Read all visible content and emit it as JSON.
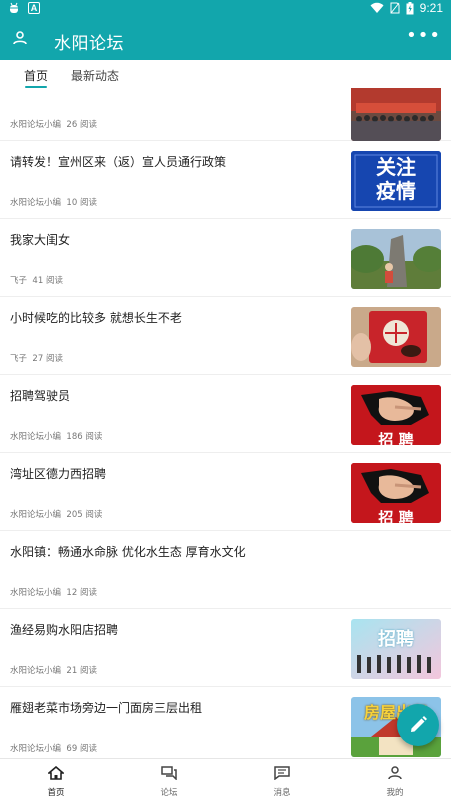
{
  "status_bar": {
    "time": "9:21"
  },
  "app_bar": {
    "title": "水阳论坛"
  },
  "tabs": [
    {
      "label": "首页",
      "active": true
    },
    {
      "label": "最新动态",
      "active": false
    }
  ],
  "posts": [
    {
      "title": "",
      "author": "水阳论坛小编",
      "reads": "26 阅读"
    },
    {
      "title": "请转发！宣州区来（返）宣人员通行政策",
      "author": "水阳论坛小编",
      "reads": "10 阅读",
      "thumb_text_1": "关注",
      "thumb_text_2": "疫情"
    },
    {
      "title": "我家大闺女",
      "author": "飞子",
      "reads": "41 阅读"
    },
    {
      "title": "小时候吃的比较多 就想长生不老",
      "author": "飞子",
      "reads": "27 阅读"
    },
    {
      "title": "招聘驾驶员",
      "author": "水阳论坛小编",
      "reads": "186 阅读",
      "thumb_text": "招 聘"
    },
    {
      "title": "湾址区德力西招聘",
      "author": "水阳论坛小编",
      "reads": "205 阅读",
      "thumb_text": "招 聘"
    },
    {
      "title": "水阳镇：畅通水命脉 优化水生态 厚育水文化",
      "author": "水阳论坛小编",
      "reads": "12 阅读"
    },
    {
      "title": "渔经易购水阳店招聘",
      "author": "水阳论坛小编",
      "reads": "21 阅读",
      "thumb_text": "招聘"
    },
    {
      "title": "雁翅老菜市场旁边一门面房三层出租",
      "author": "水阳论坛小编",
      "reads": "69 阅读",
      "thumb_text": "房屋出租"
    }
  ],
  "bottom_nav": [
    {
      "label": "首页",
      "icon": "home-icon",
      "active": true
    },
    {
      "label": "论坛",
      "icon": "forum-icon",
      "active": false
    },
    {
      "label": "消息",
      "icon": "message-icon",
      "active": false
    },
    {
      "label": "我的",
      "icon": "profile-icon",
      "active": false
    }
  ],
  "colors": {
    "accent": "#12a6ac",
    "text": "#222222",
    "meta": "#777777"
  }
}
